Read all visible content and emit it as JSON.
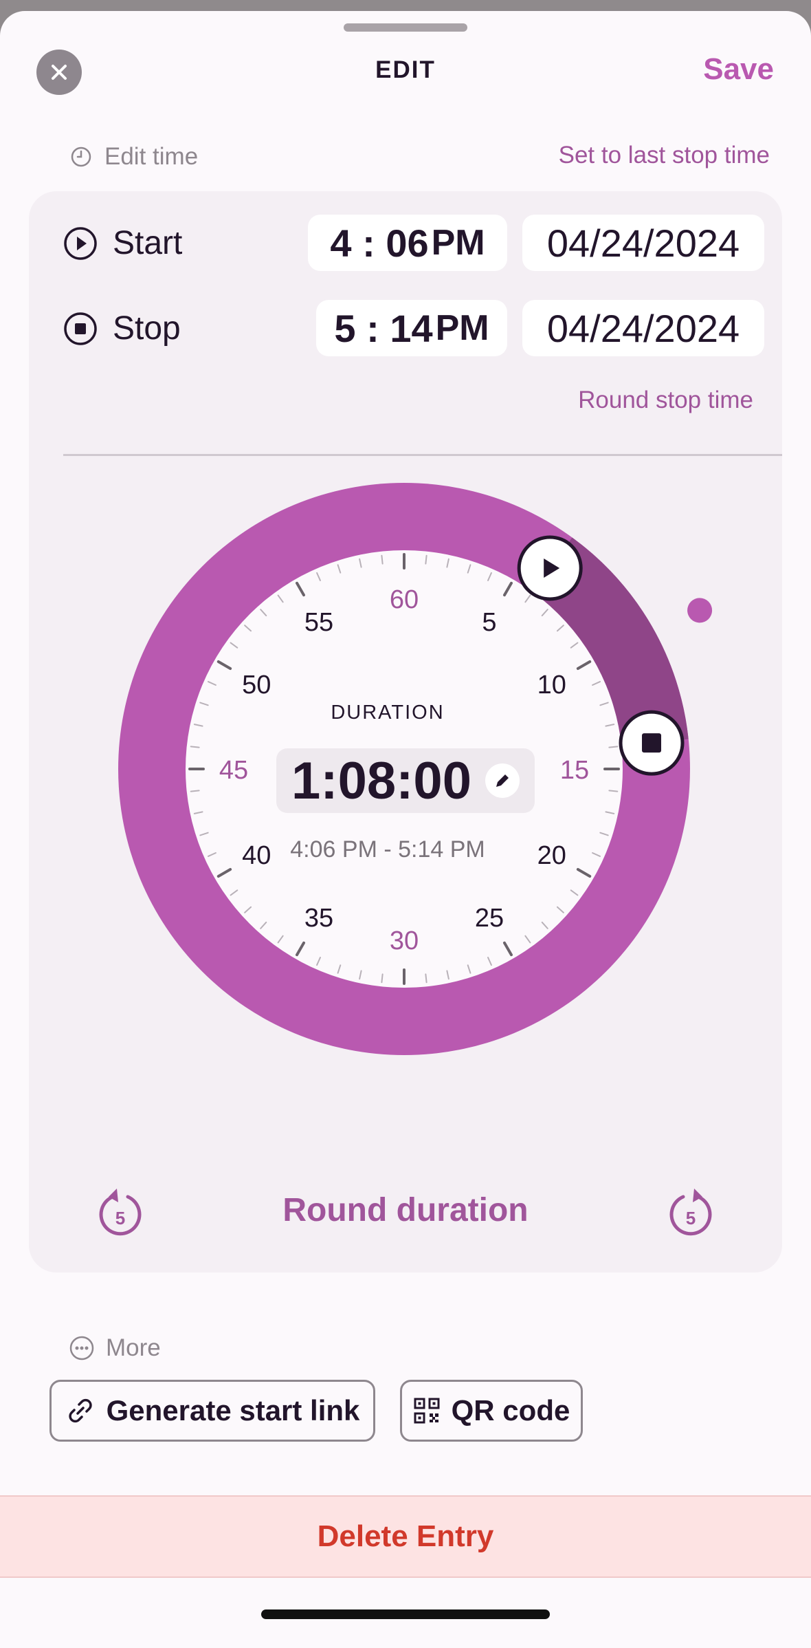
{
  "header": {
    "title": "EDIT",
    "save_label": "Save"
  },
  "edit_time": {
    "label": "Edit time",
    "last_stop_link": "Set to last stop time"
  },
  "start": {
    "label": "Start",
    "hour": "4",
    "sep": ":",
    "minute": "06",
    "ampm": "PM",
    "date": "04/24/2024"
  },
  "stop": {
    "label": "Stop",
    "hour": "5",
    "sep": ":",
    "minute": "14",
    "ampm": "PM",
    "date": "04/24/2024"
  },
  "round_stop_label": "Round stop time",
  "dial": {
    "duration_label": "DURATION",
    "duration_value": "1:08:00",
    "range_text": "4:06 PM - 5:14 PM",
    "start_minute": 6,
    "stop_minute": 14,
    "minute_labels": [
      "60",
      "5",
      "10",
      "15",
      "20",
      "25",
      "30",
      "35",
      "40",
      "45",
      "50",
      "55"
    ],
    "ring_color": "#b959b0",
    "active_arc_color": "#8f4588",
    "accent_label_color": "#a0559b"
  },
  "round_duration_label": "Round duration",
  "step_back_value": "5",
  "step_forward_value": "5",
  "more": {
    "label": "More",
    "generate_link_label": "Generate start link",
    "qr_label": "QR code"
  },
  "delete_label": "Delete Entry"
}
